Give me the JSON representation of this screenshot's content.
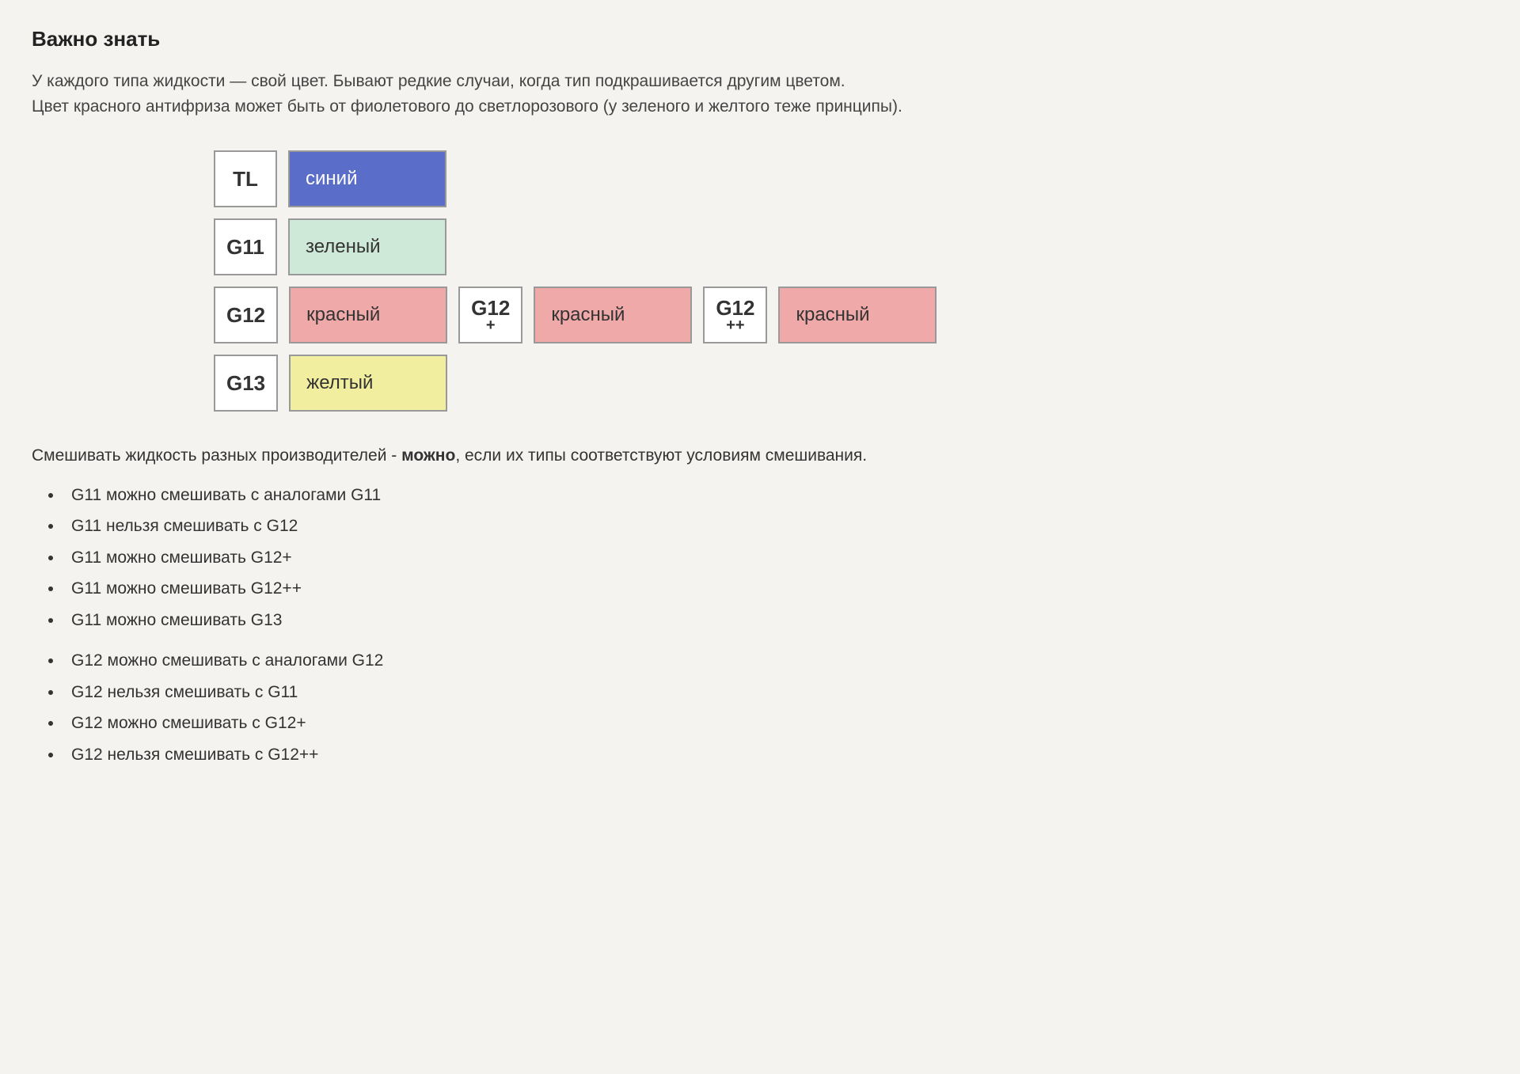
{
  "heading": "Важно знать",
  "intro_line1": "У каждого типа жидкости — свой цвет. Бывают редкие случаи, когда тип подкрашивается другим цветом.",
  "intro_line2": "Цвет красного антифриза может быть от фиолетового до светлорозового (у зеленого и желтого теже принципы).",
  "chart": {
    "rows": [
      {
        "cells": [
          {
            "code": "TL",
            "sub": ""
          },
          {
            "color": "blue",
            "label": "синий"
          }
        ]
      },
      {
        "cells": [
          {
            "code": "G11",
            "sub": ""
          },
          {
            "color": "green",
            "label": "зеленый"
          }
        ]
      },
      {
        "cells": [
          {
            "code": "G12",
            "sub": ""
          },
          {
            "color": "red",
            "label": "красный"
          },
          {
            "code": "G12",
            "sub": "+"
          },
          {
            "color": "red",
            "label": "красный"
          },
          {
            "code": "G12",
            "sub": "++"
          },
          {
            "color": "red",
            "label": "красный"
          }
        ]
      },
      {
        "cells": [
          {
            "code": "G13",
            "sub": ""
          },
          {
            "color": "yellow",
            "label": "желтый"
          }
        ]
      }
    ]
  },
  "mixing": {
    "prefix": "Смешивать жидкость разных производителей - ",
    "bold": "можно",
    "suffix": ", если их типы соответствуют условиям смешивания."
  },
  "rules_block1": [
    "G11 можно смешивать с аналогами G11",
    "G11 нельзя смешивать с G12",
    "G11 можно смешивать G12+",
    "G11 можно смешивать G12++",
    "G11 можно смешивать G13"
  ],
  "rules_block2": [
    "G12 можно смешивать с аналогами G12",
    "G12 нельзя смешивать с G11",
    "G12 можно смешивать с G12+",
    "G12 нельзя смешивать с G12++"
  ]
}
